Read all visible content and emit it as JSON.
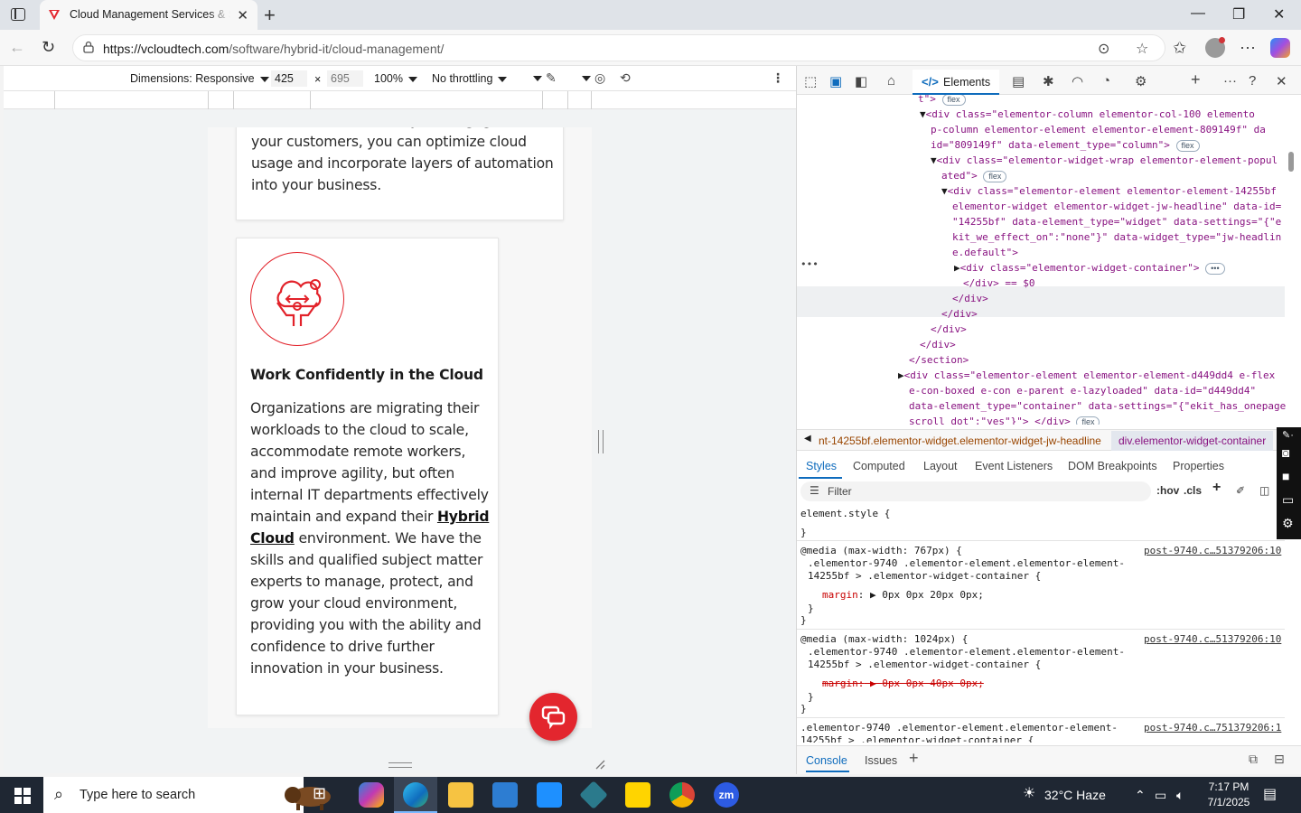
{
  "browser": {
    "tab_title": "Cloud Management Services & Solutions",
    "url_host": "https://vcloudtech.com",
    "url_path": "/software/hybrid-it/cloud-management/"
  },
  "device_toolbar": {
    "dimensions_label": "Dimensions: Responsive",
    "width": "425",
    "times": "×",
    "height": "695",
    "zoom": "100%",
    "throttling": "No throttling"
  },
  "page": {
    "card1_text": "new and innovative ways to engage with your customers, you can optimize cloud usage and incorporate layers of automation into your business.",
    "card2_heading": "Work Confidently in the Cloud",
    "card2_text_before": "Organizations are migrating their workloads to the cloud to scale, accommodate remote workers, and improve agility, but often internal IT departments effectively maintain and expand their ",
    "card2_link": "Hybrid Cloud",
    "card2_text_after": " environment. We have the skills and qualified subject matter experts to manage, protect, and grow your cloud environment, providing you with the ability and confidence to drive further innovation in your business."
  },
  "devtools": {
    "elements_tab": "Elements",
    "dom_lines": [
      "t\">",
      "<div class=\"elementor-column elementor-col-100 elemento",
      "p-column elementor-element elementor-element-809149f\" da",
      "id=\"809149f\" data-element_type=\"column\">",
      "<div class=\"elementor-widget-wrap elementor-element-popul",
      "ated\">",
      "<div class=\"elementor-element elementor-element-14255bf",
      "elementor-widget elementor-widget-jw-headline\" data-id=",
      "\"14255bf\" data-element_type=\"widget\" data-settings=\"{\"e",
      "kit_we_effect_on\":\"none\"}\" data-widget_type=\"jw-headlin",
      "e.default\">",
      "<div class=\"elementor-widget-container\">",
      "</div> == $0",
      "</div>",
      "</div>",
      "</div>",
      "</div>",
      "</section>",
      "<div class=\"elementor-element elementor-element-d449dd4 e-flex",
      "e-con-boxed e-con e-parent e-lazyloaded\" data-id=\"d449dd4\"",
      "data-element_type=\"container\" data-settings=\"{\"ekit_has_onepage",
      "scroll_dot\":\"yes\"}\"> </div>"
    ],
    "flex_badge": "flex",
    "ellipsis": "•••",
    "crumb1": "nt-14255bf.elementor-widget.elementor-widget-jw-headline",
    "crumb2": "div.elementor-widget-container",
    "style_tabs": [
      "Styles",
      "Computed",
      "Layout",
      "Event Listeners",
      "DOM Breakpoints",
      "Properties"
    ],
    "filter_placeholder": "Filter",
    "hov": ":hov",
    "cls": ".cls",
    "styles": {
      "element_style": "element.style {",
      "close_brace": "}",
      "rule1_media": "@media (max-width: 767px) {",
      "rule1_sel1": ".elementor-9740 .elementor-element.elementor-element-",
      "rule1_sel2": "14255bf > .elementor-widget-container {",
      "rule1_prop": "margin",
      "rule1_val": "0px 0px 20px 0px;",
      "rule1_src": "post-9740.c…51379206:10",
      "rule2_media": "@media (max-width: 1024px) {",
      "rule2_sel1": ".elementor-9740 .elementor-element.elementor-element-",
      "rule2_sel2": "14255bf > .elementor-widget-container {",
      "rule2_prop": "margin:",
      "rule2_val": "0px 0px 40px 0px;",
      "rule2_src": "post-9740.c…51379206:10",
      "rule3_sel1": ".elementor-9740 .elementor-element.elementor-element-",
      "rule3_sel2": "14255bf > .elementor-widget-container {",
      "rule3_src": "post-9740.c…751379206:1"
    },
    "drawer_console": "Console",
    "drawer_issues": "Issues"
  },
  "taskbar": {
    "search_placeholder": "Type here to search",
    "weather": "32°C  Haze",
    "time": "7:17 PM",
    "date": "7/1/2025"
  },
  "colors": {
    "accent_red": "#e3262e",
    "edge_blue": "#0f6cbd"
  }
}
